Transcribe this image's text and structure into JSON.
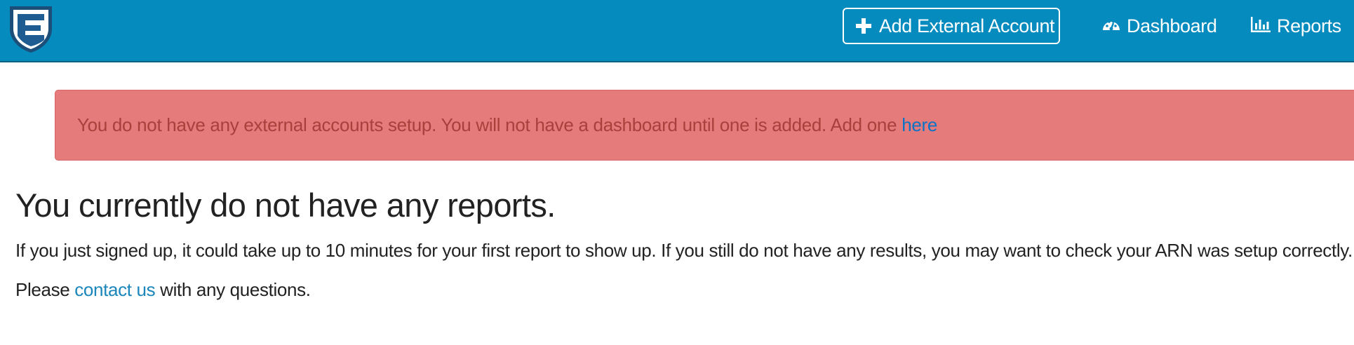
{
  "brand": {
    "logo_icon": "shield-e-logo",
    "colors": {
      "navbar": "#058bbe",
      "alert_bg": "#e57b7b",
      "alert_text": "#a8403c",
      "link": "#1a86bb"
    }
  },
  "navbar": {
    "add_account_label": "Add External Account",
    "add_account_icon": "plus-icon",
    "dashboard_label": "Dashboard",
    "dashboard_icon": "gauge-icon",
    "reports_label": "Reports",
    "reports_icon": "bar-chart-icon"
  },
  "alert": {
    "message": "You do not have any external accounts setup. You will not have a dashboard until one is added. Add one",
    "link_text": "here"
  },
  "main": {
    "heading": "You currently do not have any reports.",
    "paragraph1": "If you just signed up, it could take up to 10 minutes for your first report to show up. If you still do not have any results, you may want to check your ARN was setup correctly.",
    "paragraph2_before": "Please",
    "paragraph2_link": "contact us",
    "paragraph2_after": "with any questions."
  }
}
